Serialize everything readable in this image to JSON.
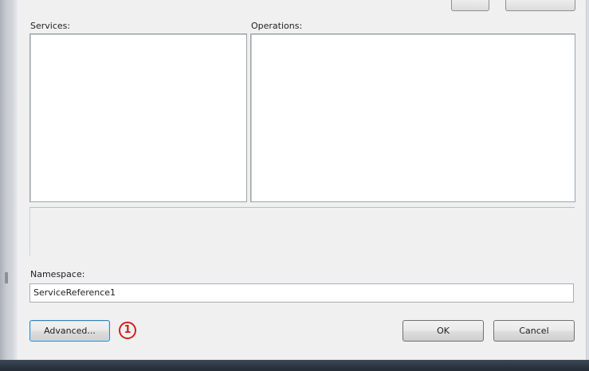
{
  "dialog": {
    "services_label": "Services:",
    "operations_label": "Operations:",
    "namespace_label": "Namespace:",
    "namespace_value": "ServiceReference1",
    "services": [],
    "operations": [],
    "status_text": ""
  },
  "buttons": {
    "advanced": "Advanced...",
    "ok": "OK",
    "cancel": "Cancel"
  },
  "annotation": {
    "step_marker": "1",
    "color": "#d2201c"
  }
}
